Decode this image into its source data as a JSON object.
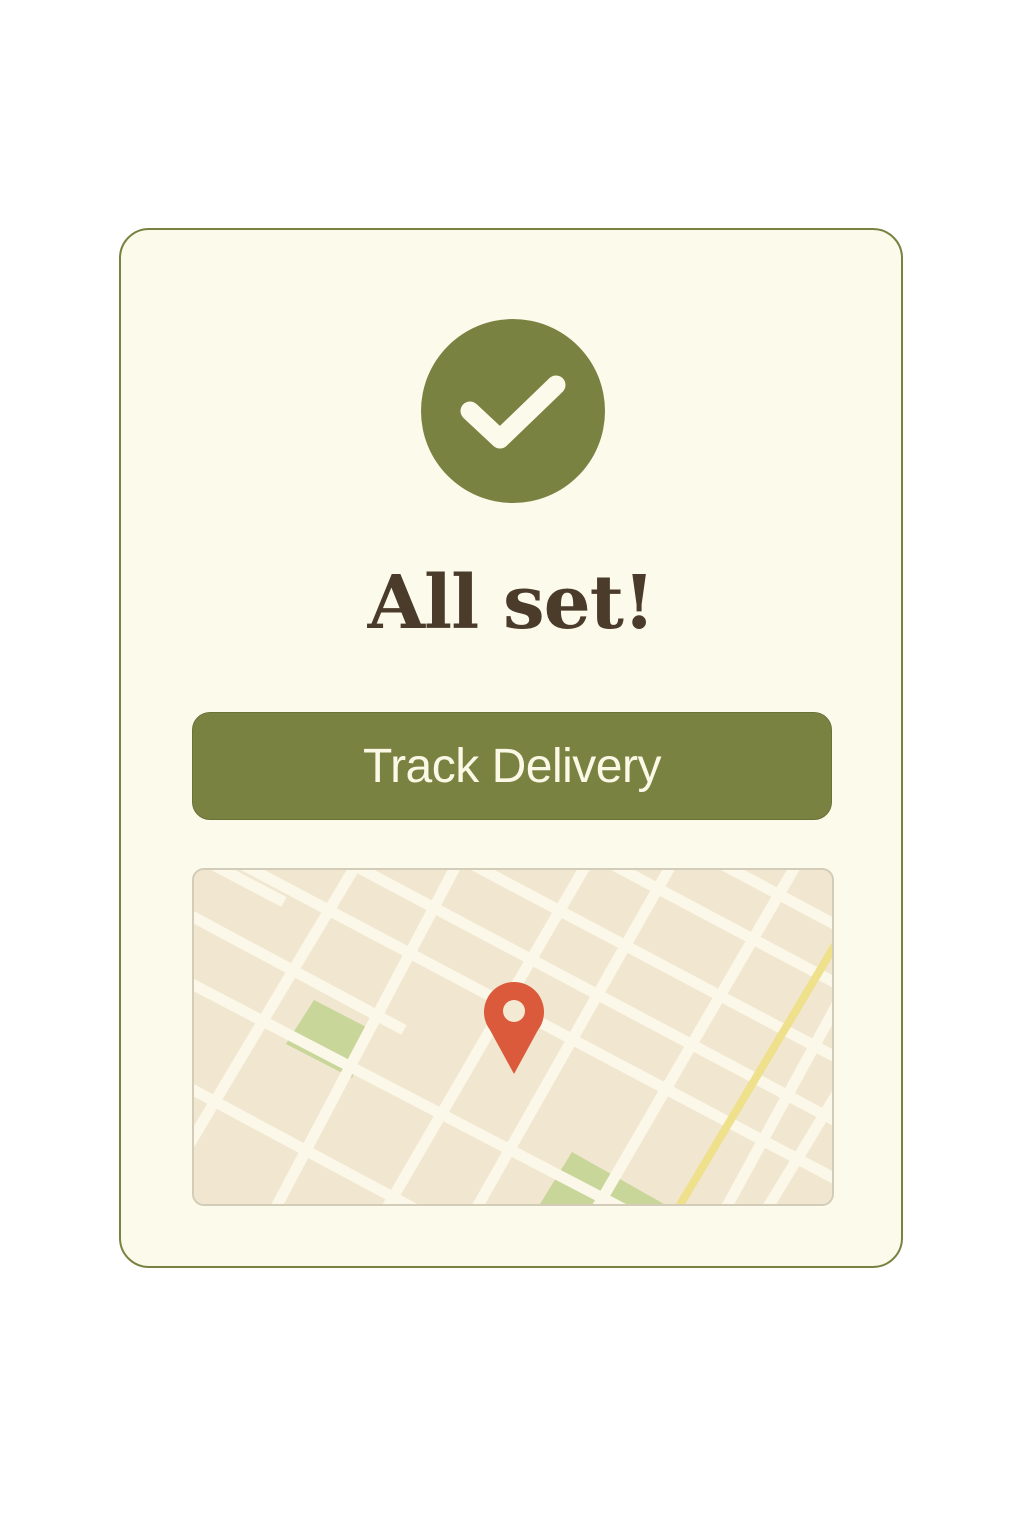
{
  "confirmation": {
    "icon": "checkmark-icon",
    "title": "All set!"
  },
  "actions": {
    "track_label": "Track Delivery"
  },
  "map": {
    "marker_icon": "location-pin-icon"
  },
  "colors": {
    "accent": "#7a8242",
    "card_background": "#fcfaeb",
    "title_text": "#4a3b2b",
    "button_text": "#fcf8e6",
    "map_background": "#f1e6cf",
    "map_road": "#fcf8e9",
    "map_park": "#c8d69a",
    "map_highway": "#efe08c",
    "pin": "#dc5a3c"
  }
}
